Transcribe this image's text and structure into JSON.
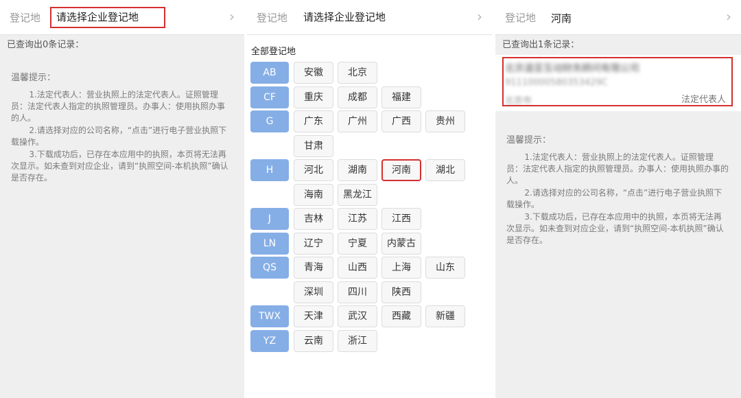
{
  "panel1": {
    "header_label": "登记地",
    "header_value": "请选择企业登记地",
    "count_text": "已查询出0条记录：",
    "tips": {
      "title": "温馨提示：",
      "items": [
        "1.法定代表人：营业执照上的法定代表人。证照管理员：法定代表人指定的执照管理员。办事人：使用执照办事的人。",
        "2.请选择对应的公司名称，“点击”进行电子营业执照下载操作。",
        "3.下载成功后，已存在本应用中的执照，本页将无法再次显示。如未查到对应企业，请到“执照空间-本机执照”确认是否存在。"
      ]
    }
  },
  "panel2": {
    "header_label": "登记地",
    "header_value": "请选择企业登记地",
    "all_label": "全部登记地",
    "groups": [
      {
        "letter": "AB",
        "provinces": [
          "安徽",
          "北京"
        ]
      },
      {
        "letter": "CF",
        "provinces": [
          "重庆",
          "成都",
          "福建"
        ]
      },
      {
        "letter": "G",
        "provinces": [
          "广东",
          "广州",
          "广西",
          "贵州",
          "甘肃"
        ]
      },
      {
        "letter": "H",
        "provinces": [
          "河北",
          "湖南",
          "河南",
          "湖北",
          "海南",
          "黑龙江"
        ]
      },
      {
        "letter": "J",
        "provinces": [
          "吉林",
          "江苏",
          "江西"
        ]
      },
      {
        "letter": "LN",
        "provinces": [
          "辽宁",
          "宁夏",
          "内蒙古"
        ]
      },
      {
        "letter": "QS",
        "provinces": [
          "青海",
          "山西",
          "上海",
          "山东",
          "深圳",
          "四川",
          "陕西"
        ]
      },
      {
        "letter": "TWX",
        "provinces": [
          "天津",
          "武汉",
          "西藏",
          "新疆"
        ]
      },
      {
        "letter": "YZ",
        "provinces": [
          "云南",
          "浙江"
        ]
      }
    ],
    "selected": "河南"
  },
  "panel3": {
    "header_label": "登记地",
    "header_value": "河南",
    "count_text": "已查询出1条记录：",
    "record": {
      "company_name": "北京道亚互动财务顾问有限公司",
      "credit_code": "91110000580353429C",
      "city": "北京市",
      "role": "法定代表人"
    },
    "tips": {
      "title": "温馨提示：",
      "items": [
        "1.法定代表人：营业执照上的法定代表人。证照管理员：法定代表人指定的执照管理员。办事人：使用执照办事的人。",
        "2.请选择对应的公司名称，“点击”进行电子营业执照下载操作。",
        "3.下载成功后，已存在本应用中的执照，本页将无法再次显示。如未查到对应企业，请到“执照空间-本机执照”确认是否存在。"
      ]
    }
  },
  "colors": {
    "letter_bg": "#86aee6",
    "highlight": "#d32f2f"
  }
}
